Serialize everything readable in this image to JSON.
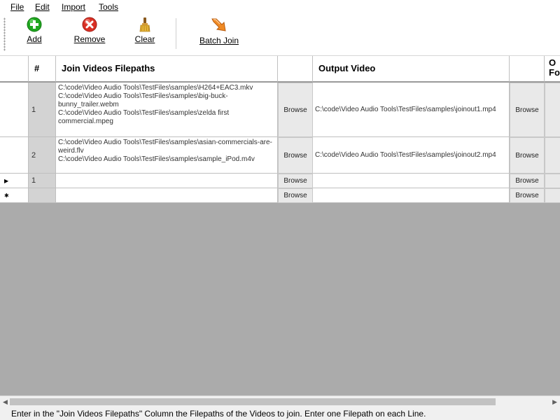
{
  "menu": {
    "file": "File",
    "edit": "Edit",
    "import": "Import",
    "tools": "Tools"
  },
  "toolbar": {
    "add": "Add",
    "remove": "Remove",
    "clear": "Clear",
    "batch_join": "Batch Join",
    "colors": {
      "add": "#1fa61f",
      "remove": "#d93025",
      "batch": "#f08a24"
    }
  },
  "grid": {
    "headers": {
      "row_number": "#",
      "join_paths": "Join Videos Filepaths",
      "output_video": "Output Video",
      "next_col_partial": "O",
      "next_col_partial2": "Fo"
    },
    "browse_label": "Browse",
    "rows": [
      {
        "number": "1",
        "paths": "C:\\code\\Video Audio Tools\\TestFiles\\samples\\H264+EAC3.mkv\nC:\\code\\Video Audio Tools\\TestFiles\\samples\\big-buck-bunny_trailer.webm\nC:\\code\\Video Audio Tools\\TestFiles\\samples\\zelda first commercial.mpeg",
        "output": "C:\\code\\Video Audio Tools\\TestFiles\\samples\\joinout1.mp4"
      },
      {
        "number": "2",
        "paths": "C:\\code\\Video Audio Tools\\TestFiles\\samples\\asian-commercials-are-weird.flv\nC:\\code\\Video Audio Tools\\TestFiles\\samples\\sample_iPod.m4v",
        "output": "C:\\code\\Video Audio Tools\\TestFiles\\samples\\joinout2.mp4"
      },
      {
        "number": "1",
        "paths": "",
        "output": "",
        "marker": "▶"
      },
      {
        "number": "",
        "paths": "",
        "output": "",
        "marker": "✱"
      }
    ]
  },
  "status": "Enter in the \"Join Videos Filepaths\" Column the Filepaths of the Videos to join. Enter one Filepath on each Line."
}
